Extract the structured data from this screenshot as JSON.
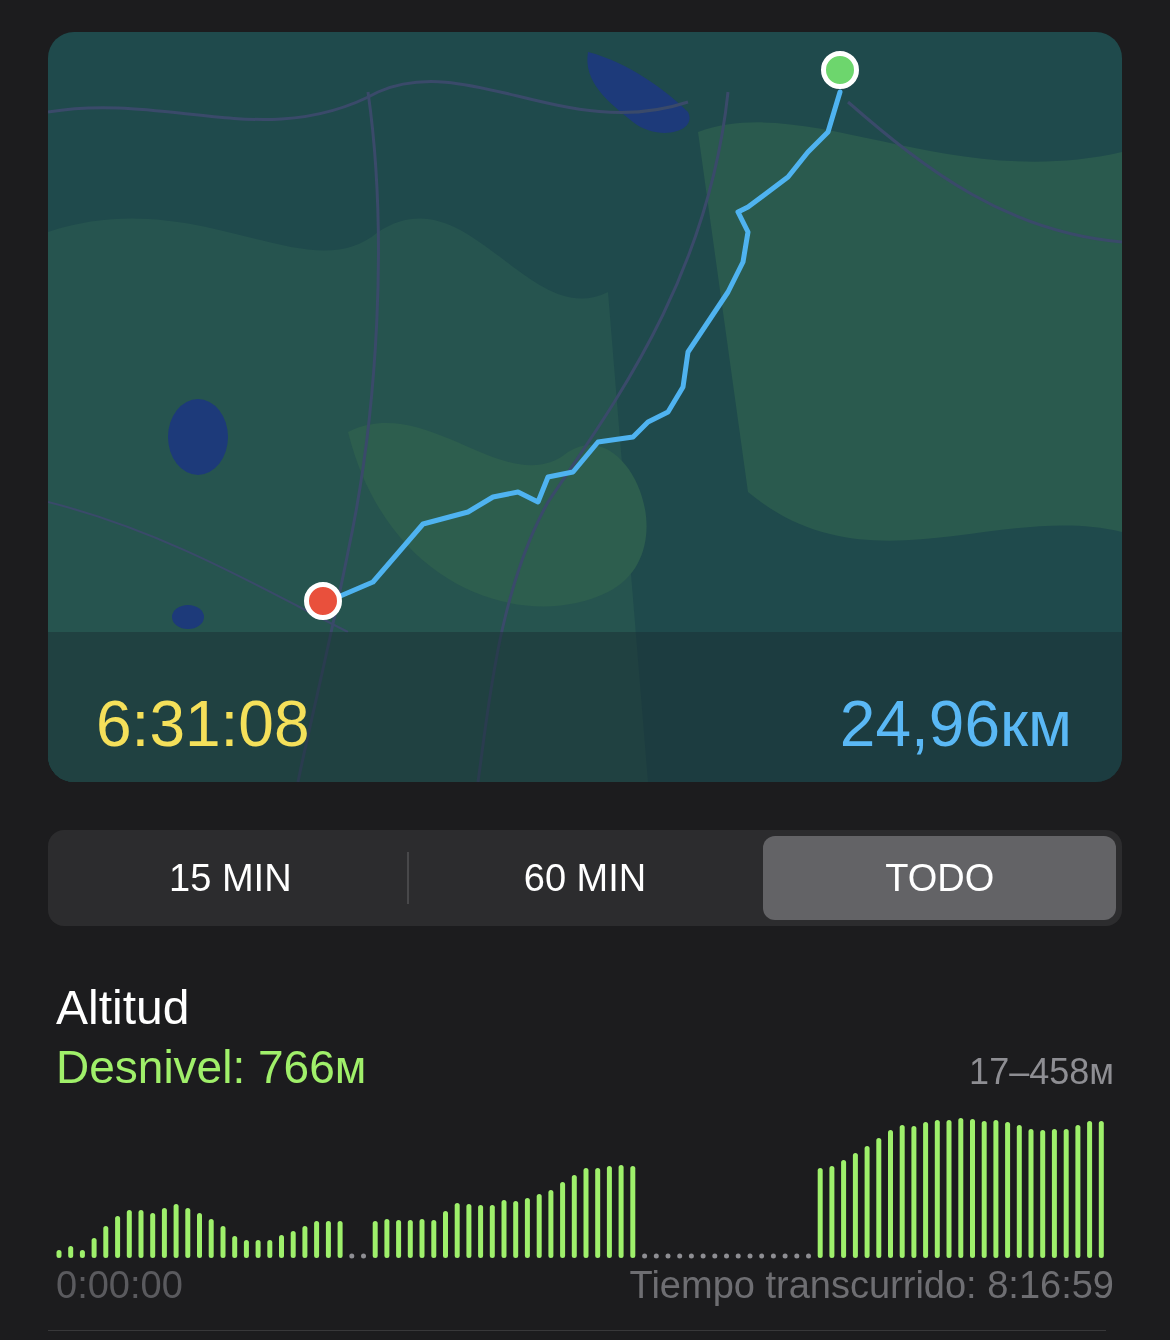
{
  "map": {
    "duration": "6:31:08",
    "distance": "24,96км"
  },
  "range_tabs": [
    {
      "label": "15 MIN",
      "selected": false
    },
    {
      "label": "60 MIN",
      "selected": false
    },
    {
      "label": "TODO",
      "selected": true
    }
  ],
  "altitude": {
    "title": "Altitud",
    "gain": "Desnivel: 766м",
    "range": "17–458м",
    "start_time": "0:00:00",
    "elapsed": "Tiempo transcurrido: 8:16:59"
  }
}
